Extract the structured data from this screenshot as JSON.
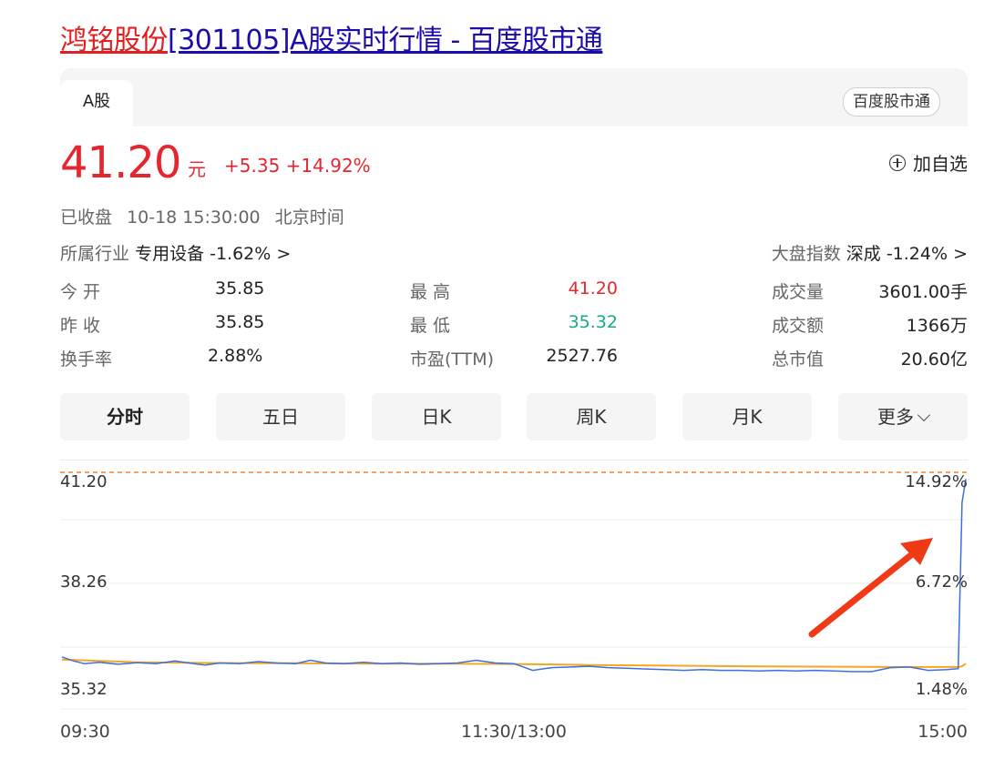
{
  "header": {
    "name_link": "鸿铭股份",
    "title_rest": "[301105]A股实时行情 - 百度股市通"
  },
  "tabs": {
    "active": "A股",
    "brand": "百度股市通"
  },
  "quote": {
    "price": "41.20",
    "unit": "元",
    "change": "+5.35",
    "change_pct": "+14.92%",
    "watch_label": "加自选",
    "status": "已收盘",
    "time": "10-18 15:30:00",
    "timezone": "北京时间",
    "industry_label": "所属行业",
    "industry_value": "专用设备 -1.62% >",
    "index_label": "大盘指数",
    "index_value": "深成 -1.24% >"
  },
  "stats": [
    {
      "label": "今 开",
      "value": "35.85"
    },
    {
      "label": "最 高",
      "value": "41.20"
    },
    {
      "label": "成交量",
      "value": "3601.00手"
    },
    {
      "label": "昨 收",
      "value": "35.85"
    },
    {
      "label": "最 低",
      "value": "35.32"
    },
    {
      "label": "成交额",
      "value": "1366万"
    },
    {
      "label": "换手率",
      "value": "2.88%"
    },
    {
      "label": "市盈(TTM)",
      "value": "2527.76"
    },
    {
      "label": "总市值",
      "value": "20.60亿"
    }
  ],
  "periods": [
    "分时",
    "五日",
    "日K",
    "周K",
    "月K",
    "更多"
  ],
  "colors": {
    "up": "#e5262f",
    "down": "#19a78a",
    "price_line": "#3b6fe0",
    "avg_line": "#f5a623",
    "ref_line": "#f08030",
    "arrow": "#f03a17"
  },
  "chart_data": {
    "type": "line",
    "y_left_labels": [
      "41.20",
      "38.26",
      "35.32"
    ],
    "y_right_labels": [
      "14.92%",
      "6.72%",
      "1.48%"
    ],
    "x_labels": [
      "09:30",
      "11:30/13:00",
      "15:00"
    ],
    "ylim": [
      35.0,
      41.4
    ],
    "x_range": [
      0,
      240
    ],
    "prev_close": 35.85,
    "series": [
      {
        "x": [
          0,
          3,
          6,
          10,
          15,
          20,
          25,
          30,
          35,
          38,
          42,
          47,
          52,
          57,
          62,
          66,
          70,
          75,
          80,
          85,
          90,
          95,
          100,
          105,
          110,
          115,
          120,
          125,
          130,
          135,
          140,
          145,
          150,
          155,
          160,
          165,
          170,
          175,
          180,
          185,
          190,
          195,
          200,
          205,
          210,
          215,
          220,
          225,
          230,
          235,
          238,
          239,
          240
        ],
        "values": [
          35.9,
          35.78,
          35.7,
          35.74,
          35.68,
          35.73,
          35.7,
          35.78,
          35.7,
          35.66,
          35.72,
          35.7,
          35.76,
          35.72,
          35.7,
          35.8,
          35.72,
          35.7,
          35.74,
          35.7,
          35.72,
          35.68,
          35.7,
          35.72,
          35.8,
          35.72,
          35.7,
          35.5,
          35.58,
          35.6,
          35.62,
          35.58,
          35.56,
          35.54,
          35.52,
          35.5,
          35.52,
          35.5,
          35.5,
          35.48,
          35.5,
          35.48,
          35.5,
          35.48,
          35.46,
          35.46,
          35.58,
          35.6,
          35.5,
          35.52,
          35.55,
          40.5,
          41.2
        ]
      },
      {
        "x": [
          0,
          20,
          40,
          60,
          80,
          100,
          120,
          140,
          160,
          180,
          200,
          220,
          238,
          239,
          240
        ],
        "values": [
          35.82,
          35.74,
          35.72,
          35.71,
          35.7,
          35.7,
          35.69,
          35.66,
          35.64,
          35.62,
          35.61,
          35.6,
          35.6,
          35.62,
          35.7
        ]
      }
    ]
  }
}
